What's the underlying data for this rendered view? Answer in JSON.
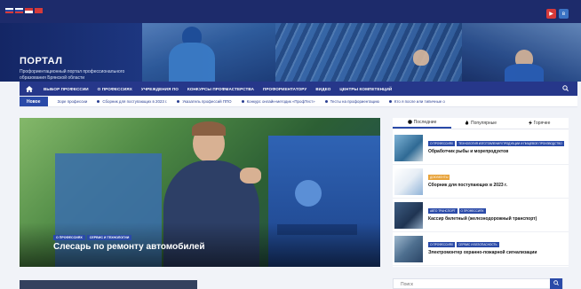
{
  "site": {
    "brand": "ПОРТАЛ",
    "tagline": "Профориентационный портал профессионального образования Брянской области"
  },
  "colors": {
    "primary": "#26378a",
    "accent": "#2a4aa8",
    "tag_orange": "#e8a33a",
    "tag_blue": "#2a4aa8"
  },
  "social": [
    {
      "icon": "youtube-icon",
      "glyph": "▶",
      "color": "#d63a3a"
    },
    {
      "icon": "vk-icon",
      "glyph": "в",
      "color": "#3b73c4"
    }
  ],
  "nav": {
    "home_icon": "home-icon",
    "items": [
      "ВЫБОР ПРОФЕССИИ",
      "О ПРОФЕССИЯХ",
      "УЧРЕЖДЕНИЯ ПО",
      "КОНКУРСЫ ПРОФМАСТЕРСТВА",
      "ПРОФОРИЕНТАТОРУ",
      "ВИДЕО",
      "ЦЕНТРЫ КОМПЕТЕНЦИЙ"
    ],
    "search_icon": "search-icon"
  },
  "ticker": {
    "label": "Новое",
    "items": [
      "Зоре профессии",
      "Сборник для поступающих в 2023 г.",
      "Указатель профессий ППО",
      "Конкурс онлайн-методик «ПрофТест»",
      "Тесты на профориентацию",
      "Кто я после или типичные о"
    ]
  },
  "hero": {
    "tags": [
      "О ПРОФЕССИЯХ",
      "СЕРВИС И ТЕХНОЛОГИИ"
    ],
    "title": "Слесарь по ремонту автомобилей"
  },
  "sidebar": {
    "tabs": [
      {
        "label": "Последние",
        "icon": "clock-icon"
      },
      {
        "label": "Популярные",
        "icon": "flame-icon"
      },
      {
        "label": "Горячее",
        "icon": "bolt-icon"
      }
    ],
    "posts": [
      {
        "tags": [
          "О ПРОФЕССИЯХ",
          "ТЕХНОЛОГИЯ ИЗГОТОВЛЕНИЯ ПРОДУКЦИИ И ПИЩЕВОЕ ПРОИЗВОДСТВО"
        ],
        "title": "Обработчик рыбы и морепродуктов"
      },
      {
        "tags": [
          "ДОКУМЕНТЫ"
        ],
        "title": "Сборник для поступающих в 2023 г."
      },
      {
        "tags": [
          "АВТО ТРАНСПОРТ",
          "О ПРОФЕССИЯХ"
        ],
        "title": "Кассир билетный (железнодорожный транспорт)"
      },
      {
        "tags": [
          "О ПРОФЕССИЯХ",
          "СЕРВИС И БЕЗОПАСНОСТЬ"
        ],
        "title": "Электромонтер охранно-пожарной сигнализации"
      }
    ]
  },
  "search": {
    "placeholder": "Поиск",
    "button_icon": "search-icon"
  }
}
